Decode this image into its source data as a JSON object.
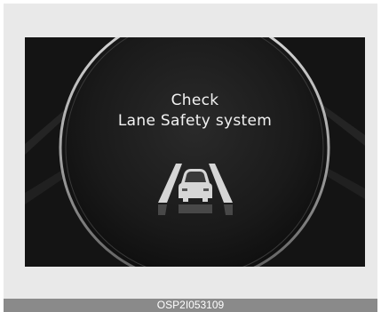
{
  "display": {
    "message_line1": "Check",
    "message_line2": "Lane Safety system"
  },
  "icons": {
    "warning_icon": "lane-safety-icon"
  },
  "caption": {
    "code": "OSP2I053109"
  },
  "colors": {
    "screen_bg": "#141414",
    "ring": "#c8c8c8",
    "text": "#f2f2f2",
    "caption_bg": "#8a8a8a"
  }
}
